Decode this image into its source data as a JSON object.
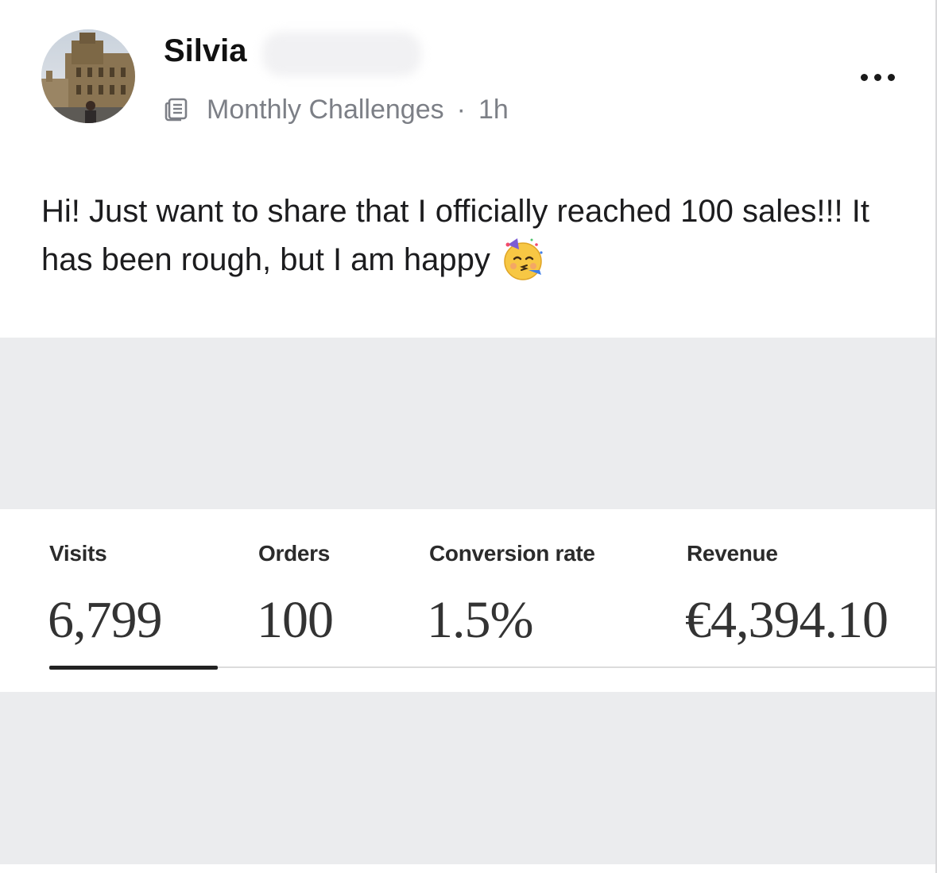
{
  "post": {
    "author": {
      "first_name": "Silvia"
    },
    "group_icon": "feed-icon",
    "group": "Monthly Challenges",
    "separator": "·",
    "time_ago": "1h",
    "more_icon": "more-horizontal-icon",
    "body": "Hi! Just want to share that I officially reached 100 sales!!! It has been rough, but I am happy",
    "emoji": "partying-face-emoji"
  },
  "stats": {
    "items": [
      {
        "label": "Visits",
        "value": "6,799"
      },
      {
        "label": "Orders",
        "value": "100"
      },
      {
        "label": "Conversion rate",
        "value": "1.5%"
      },
      {
        "label": "Revenue",
        "value": "€4,394.10"
      }
    ],
    "selected": "Visits"
  },
  "colors": {
    "meta_text": "#7c7f86",
    "attachment_bg": "#ebecee",
    "underline": "#222222"
  }
}
